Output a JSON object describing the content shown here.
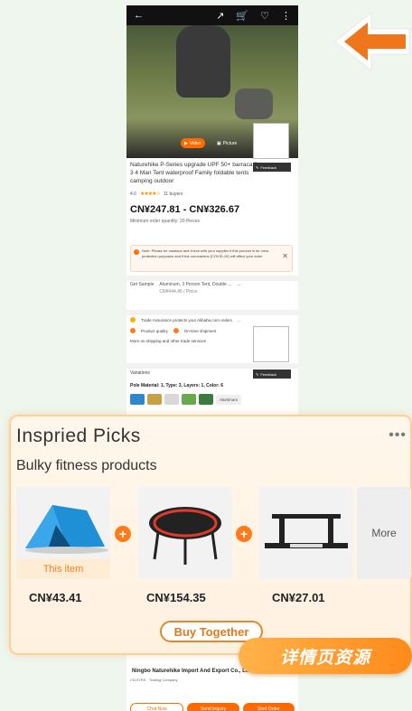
{
  "topbar": {
    "back_icon": "back-arrow-icon",
    "icons": [
      "share-icon",
      "cart-icon",
      "favorite-heart-icon",
      "more-vertical-icon"
    ]
  },
  "media": {
    "video_label": "Video",
    "picture_label": "Picture",
    "feedback_label": "Feedback"
  },
  "product": {
    "title": "Naturehike P-Series upgrade UPF 50+ barraca 2 3 4 Man Tent waterproof Family foldable tents camping outdoor",
    "rating": "4.0",
    "stars": "★★★★☆",
    "buyers": "11 buyers",
    "price_range": "CN¥247.81 - CN¥326.67",
    "moq": "Minimum order quantity: 20 Pieces"
  },
  "notice": {
    "text": "Note: Please be cautious and check with your supplier if this product is for virus protection purposes and if the coronavirus (COVID-19) will affect your order"
  },
  "sample": {
    "label": "Get Sample",
    "value": "Aluminum, 3 Person Tent, Double ...",
    "price": "CN¥444.45 / Piece",
    "more": "..."
  },
  "assurance": {
    "title": "Trade Assurance protects your Alibaba.com orders",
    "quality": "Product quality",
    "ontime": "On-time shipment",
    "more_info": "More on shipping and other trade services",
    "more": "..."
  },
  "variations": {
    "label": "Variations",
    "pole": "Pole Material: 1, Type: 3, Layers: 1, Color: 6",
    "swatch_label": "Aluminum",
    "swatch_colors": [
      "#2f86c9",
      "#c9a04a",
      "#d8d8d8",
      "#6aa84f",
      "#3d7a3d"
    ]
  },
  "picks": {
    "title": "Inspried Picks",
    "subtitle": "Bulky fitness products",
    "more_dots": "•••",
    "this_item": "This item",
    "more_label": "More",
    "prices": [
      "CN¥43.41",
      "CN¥154.35",
      "CN¥27.01"
    ],
    "buy_together": "Buy Together"
  },
  "badge": "详情页资源",
  "supplier": {
    "name": "Ningbo Naturehike Import And Export Co., Ltd.",
    "meta": "CN 5YRS · Trading Company"
  },
  "actions": {
    "chat": "Chat Now",
    "inquiry": "Send Inquiry",
    "order": "Start Order"
  },
  "colors": {
    "accent": "#ff6a00",
    "arrow": "#f0761c",
    "panel_border": "#ffcf98"
  }
}
